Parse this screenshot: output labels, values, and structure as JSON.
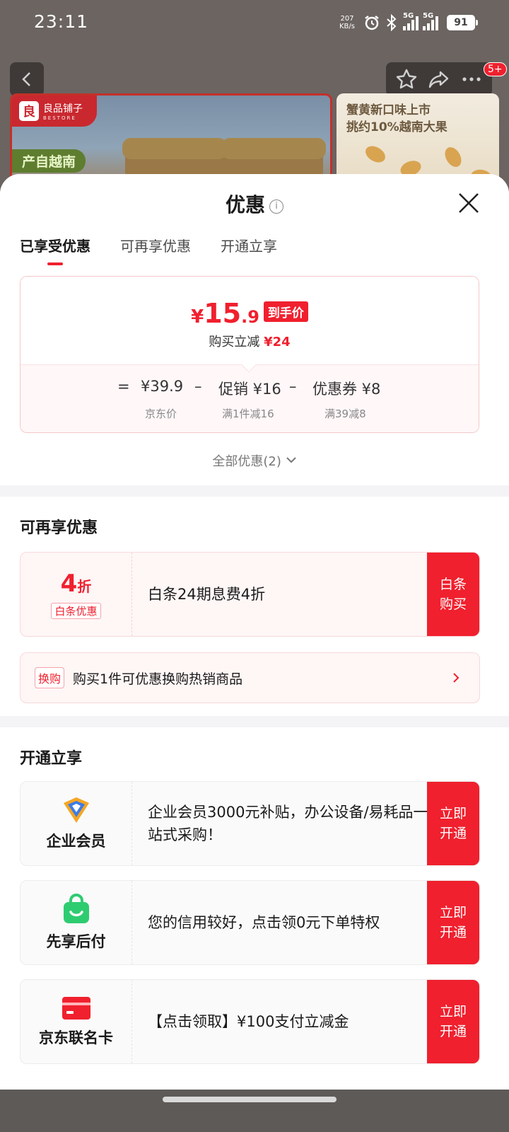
{
  "status": {
    "time": "23:11",
    "speed_top": "207",
    "speed_unit": "KB/s",
    "net1": "5G",
    "net2": "5G",
    "battery": "91"
  },
  "bg": {
    "badge": "5+",
    "brand_name": "良品铺子",
    "brand_en": "BESTORE",
    "brand_logo": "良",
    "origin": "产自越南",
    "promo_line1": "蟹黄新口味上市",
    "promo_line2": "挑约10%越南大果"
  },
  "sheet": {
    "title": "优惠",
    "tabs": [
      "已享受优惠",
      "可再享优惠",
      "开通立享"
    ],
    "price": {
      "yen": "¥",
      "int": "15",
      "dec": ".9",
      "tag": "到手价",
      "reduce_label": "购买立减",
      "reduce_value": "¥24"
    },
    "calc": {
      "eq": "=",
      "base": "¥39.9",
      "minus": "–",
      "promo": "促销 ¥16",
      "coupon": "优惠券 ¥8",
      "base_sub": "京东价",
      "promo_sub": "满1件减16",
      "coupon_sub": "满39减8"
    },
    "all_offers": "全部优惠(2)",
    "more_title": "可再享优惠",
    "baitiao": {
      "discount": "4",
      "discount_unit": "折",
      "tag": "白条优惠",
      "text": "白条24期息费4折",
      "button": "白条购买"
    },
    "swap": {
      "tag": "换购",
      "text": "购买1件可优惠换购热销商品"
    },
    "open_title": "开通立享",
    "open_items": [
      {
        "label": "企业会员",
        "text": "企业会员3000元补贴，办公设备/易耗品一站式采购！",
        "button": "立即开通"
      },
      {
        "label": "先享后付",
        "text": "您的信用较好，点击领0元下单特权",
        "button": "立即开通"
      },
      {
        "label": "京东联名卡",
        "text": "【点击领取】¥100支付立减金",
        "button": "立即开通"
      }
    ]
  },
  "icons": {
    "back": "chevron-left-icon",
    "star": "star-icon",
    "share": "share-icon",
    "more": "more-icon",
    "info": "info-icon",
    "close": "close-icon",
    "arrow": "chevron-right-icon"
  },
  "colors": {
    "accent": "#f0202e"
  }
}
